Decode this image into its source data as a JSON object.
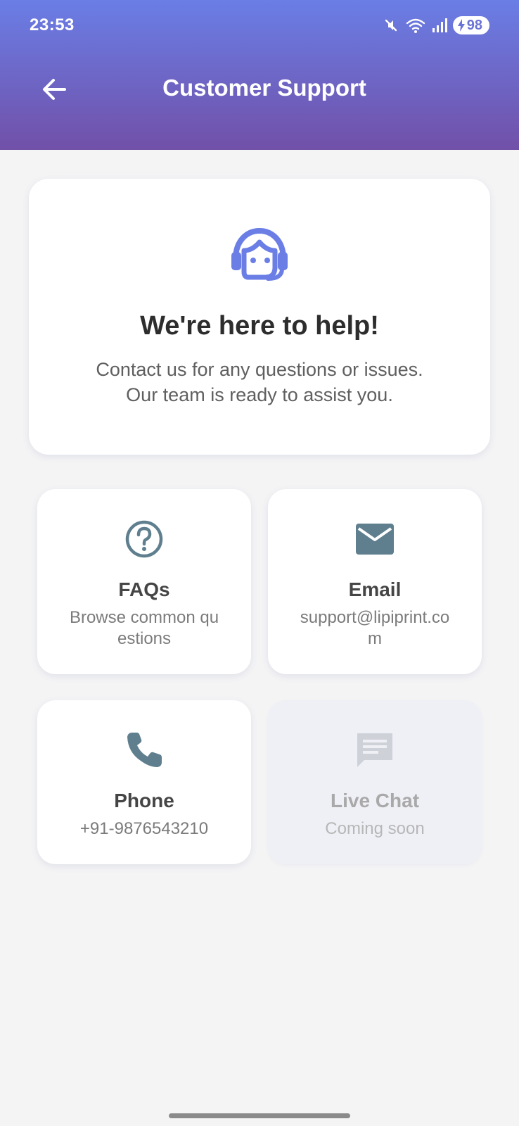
{
  "status_bar": {
    "time": "23:53",
    "battery": "98",
    "icons": [
      "mute-icon",
      "wifi-icon",
      "signal-icon",
      "battery-charging-icon"
    ]
  },
  "header": {
    "title": "Customer Support",
    "back_icon": "arrow-left-icon"
  },
  "hero": {
    "icon": "support-agent-icon",
    "title": "We're here to help!",
    "line1": "Contact us for any questions or issues.",
    "line2": "Our team is ready to assist you."
  },
  "tiles": [
    {
      "icon": "help-circle-icon",
      "title": "FAQs",
      "subtitle": "Browse common questions",
      "enabled": true
    },
    {
      "icon": "email-icon",
      "title": "Email",
      "subtitle": "support@lipiprint.com",
      "enabled": true
    },
    {
      "icon": "phone-icon",
      "title": "Phone",
      "subtitle": "+91-9876543210",
      "enabled": true
    },
    {
      "icon": "chat-icon",
      "title": "Live Chat",
      "subtitle": "Coming soon",
      "enabled": false
    }
  ],
  "colors": {
    "header_gradient_top": "#6a7ee6",
    "header_gradient_bottom": "#7150a8",
    "accent": "#6a7ee6",
    "tile_icon": "#5f7f8f",
    "disabled_icon": "#cfd1d8",
    "background": "#f4f4f5"
  }
}
